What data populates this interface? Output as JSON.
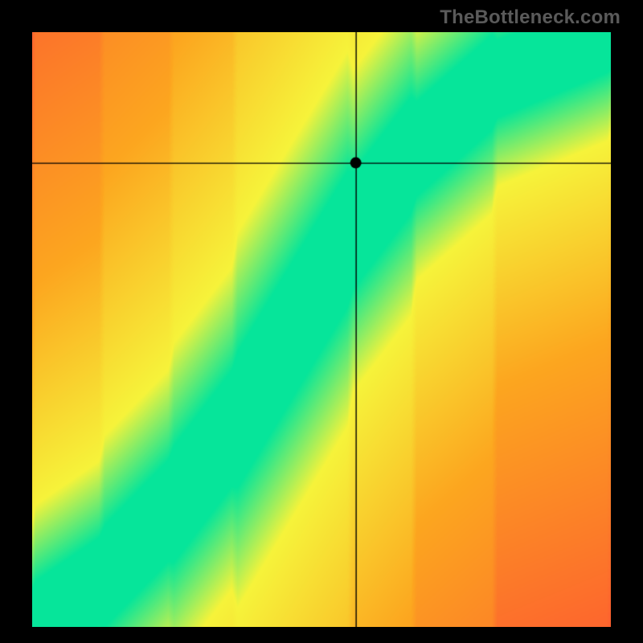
{
  "attribution": "TheBottleneck.com",
  "chart_data": {
    "type": "heatmap",
    "title": "",
    "xlabel": "",
    "ylabel": "",
    "xlim": [
      0,
      100
    ],
    "ylim": [
      0,
      100
    ],
    "grid": false,
    "legend": false,
    "marker": {
      "x": 56,
      "y": 78
    },
    "crosshair": {
      "x": 56,
      "y": 78
    },
    "ridge": {
      "description": "optimal-match diagonal band (green) through heatmap",
      "points": [
        {
          "x": 0,
          "y": 0
        },
        {
          "x": 12,
          "y": 8
        },
        {
          "x": 24,
          "y": 20
        },
        {
          "x": 35,
          "y": 34
        },
        {
          "x": 45,
          "y": 50
        },
        {
          "x": 55,
          "y": 66
        },
        {
          "x": 66,
          "y": 80
        },
        {
          "x": 80,
          "y": 92
        },
        {
          "x": 100,
          "y": 100
        }
      ],
      "half_width_data_units": 6
    },
    "colors": {
      "ridge": "#06e59a",
      "near": "#f6f33a",
      "mid": "#fca61f",
      "far": "#fd3f36"
    }
  }
}
